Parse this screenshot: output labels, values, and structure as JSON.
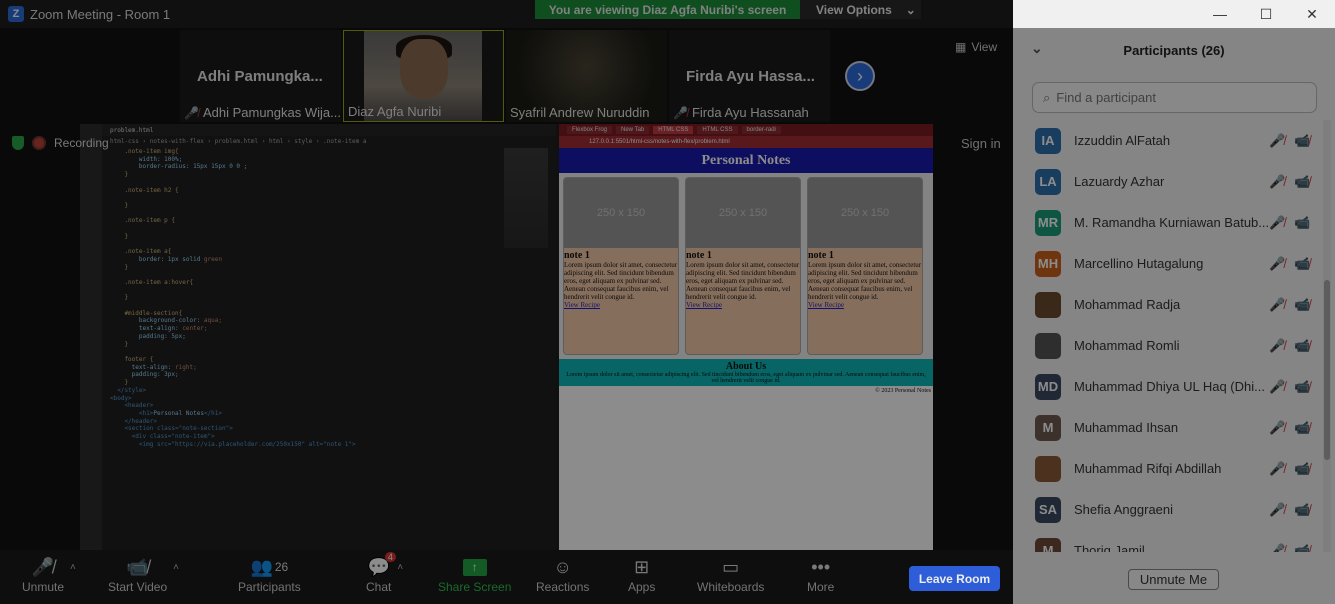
{
  "window": {
    "title": "Zoom Meeting - Room 1",
    "logo": "Z"
  },
  "banner": {
    "viewing": "You are viewing Diaz Agfa Nuribi's screen",
    "view_options": "View Options"
  },
  "win_controls": {
    "minimize": "—",
    "maximize": "☐",
    "close": "✕"
  },
  "thumbnails": [
    {
      "big_name": "Adhi Pamungka...",
      "name": "Adhi Pamungkas Wija..."
    },
    {
      "big_name": "",
      "name": "Diaz Agfa Nuribi"
    },
    {
      "big_name": "",
      "name": "Syafril Andrew Nuruddin"
    },
    {
      "big_name": "Firda Ayu Hassa...",
      "name": "Firda Ayu Hassanah"
    }
  ],
  "view_label": "View",
  "recording": "Recording",
  "sign_in": "Sign in",
  "shared": {
    "editor_tab": "problem.html",
    "breadcrumb": "html-css › notes-with-flex › problem.html › html › style › .note-item a",
    "browser_tabs": [
      "Flexbox Frog",
      "New Tab",
      "HTML CSS",
      "HTML CSS",
      "border-radi"
    ],
    "url": "127.0.0.1:5501/html-css/notes-with-flex/problem.html",
    "page_title": "Personal Notes",
    "placeholder": "250 x 150",
    "note_titles": [
      "note 1",
      "note 1",
      "note 1"
    ],
    "lorem": "Lorem ipsum dolor sit amet, consectetur adipiscing elit. Sed tincidunt bibendum eros, eget aliquam ex pulvinar sed. Aenean consequat faucibus enim, vel hendrerit velit congue id.",
    "view_recipe": "View Recipe",
    "about_title": "About Us",
    "about_text": "Lorem ipsum dolor sit amet, consectetur adipiscing elit. Sed tincidunt bibendum eros, eget aliquam ex pulvinar sed. Aenean consequat faucibus enim, vel hendrerit velit congue id.",
    "footer": "© 2023 Personal Notes"
  },
  "toolbar": {
    "unmute": "Unmute",
    "start_video": "Start Video",
    "participants": "Participants",
    "participants_count": "26",
    "chat": "Chat",
    "chat_badge": "4",
    "share_screen": "Share Screen",
    "reactions": "Reactions",
    "apps": "Apps",
    "whiteboards": "Whiteboards",
    "more": "More",
    "leave": "Leave Room"
  },
  "panel": {
    "title": "Participants (26)",
    "search_placeholder": "Find a participant",
    "unmute_me": "Unmute Me",
    "participants": [
      {
        "initials": "IA",
        "name": "Izzuddin AlFatah",
        "color": "#2f6fae",
        "video": false
      },
      {
        "initials": "LA",
        "name": "Lazuardy Azhar",
        "color": "#2f6fae",
        "video": false
      },
      {
        "initials": "MR",
        "name": "M. Ramandha Kurniawan Batub...",
        "color": "#1a9b7a",
        "video": true
      },
      {
        "initials": "MH",
        "name": "Marcellino Hutagalung",
        "color": "#c9621a",
        "video": false
      },
      {
        "initials": "",
        "name": "Mohammad Radja",
        "color": "#6b4a2f",
        "video": false
      },
      {
        "initials": "",
        "name": "Mohammad Romli",
        "color": "#555555",
        "video": false
      },
      {
        "initials": "MD",
        "name": "Muhammad Dhiya UL Haq (Dhi...",
        "color": "#3b4a63",
        "video": false
      },
      {
        "initials": "M",
        "name": "Muhammad Ihsan",
        "color": "#6e5a4f",
        "video": false
      },
      {
        "initials": "",
        "name": "Muhammad Rifqi Abdillah",
        "color": "#8a5a3a",
        "video": false
      },
      {
        "initials": "SA",
        "name": "Shefia Anggraeni",
        "color": "#3b4a63",
        "video": false
      },
      {
        "initials": "M",
        "name": "Thoriq Jamil",
        "color": "#6e4a3a",
        "video": false
      }
    ]
  }
}
